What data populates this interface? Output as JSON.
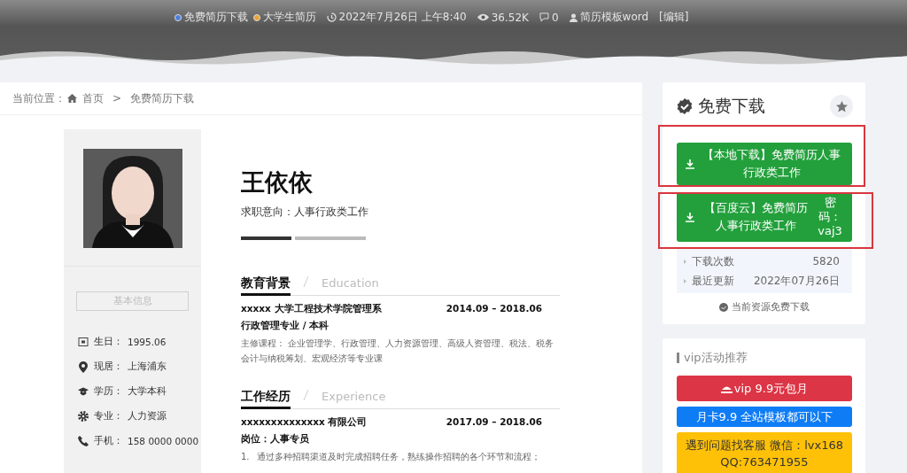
{
  "header": {
    "meta": [
      {
        "kind": "category",
        "text": "免费简历下载",
        "color": "#4a7fe0"
      },
      {
        "kind": "category",
        "text": "大学生简历",
        "color": "#e8a33a"
      },
      {
        "kind": "date",
        "text": "2022年7月26日 上午8:40"
      },
      {
        "kind": "views",
        "text": "36.52K"
      },
      {
        "kind": "comments",
        "text": "0"
      },
      {
        "kind": "author",
        "text": "简历模板word"
      },
      {
        "kind": "edit",
        "text": "[编辑]"
      }
    ]
  },
  "breadcrumb": {
    "label": "当前位置：",
    "separator": ">",
    "items": [
      "首页",
      "免费简历下载"
    ]
  },
  "resume": {
    "name": "王依依",
    "intention": "求职意向：人事行政类工作",
    "basic_title": "基本信息",
    "info": [
      {
        "kind": "calendar",
        "label": "生日：",
        "value": "1995.06"
      },
      {
        "kind": "pin",
        "label": "现居：",
        "value": "上海浦东"
      },
      {
        "kind": "cap",
        "label": "学历：",
        "value": "大学本科"
      },
      {
        "kind": "gear",
        "label": "专业：",
        "value": "人力资源"
      },
      {
        "kind": "phone",
        "label": "手机：",
        "value": "158 0000 0000"
      }
    ],
    "sections": [
      {
        "title": "教育背景",
        "subtitle": "Education",
        "entries": [
          {
            "org": "xxxxx 大学工程技术学院管理系",
            "date": "2014.09 – 2018.06",
            "role": "行政管理专业 / 本科",
            "text": "主修课程： 企业管理学、行政管理、人力资源管理、高级人资管理、税法、税务会计与纳税筹划、宏观经济等专业课"
          }
        ]
      },
      {
        "title": "工作经历",
        "subtitle": "Experience",
        "entries": [
          {
            "org": "xxxxxxxxxxxxxx 有限公司",
            "date": "2017.09 – 2018.06",
            "role": "岗位：人事专员",
            "items": [
              {
                "number": "1.",
                "text": "通过多种招聘渠道及时完成招聘任务，熟练操作招聘的各个环节和流程；"
              }
            ]
          }
        ]
      }
    ]
  },
  "sidebar": {
    "download": {
      "title": "免费下载",
      "buttons": [
        {
          "text": "【本地下载】免费简历人事行政类工作",
          "highlighted": true
        },
        {
          "text": "【百度云】免费简历人事行政类工作",
          "extra": "密码：vaj3",
          "highlighted": true
        }
      ],
      "stats": [
        {
          "label": "下载次数",
          "value": "5820"
        },
        {
          "label": "最近更新",
          "value": "2022年07月26日"
        }
      ],
      "note": "当前资源免费下载"
    },
    "vip": {
      "title": "vip活动推荐",
      "buttons": [
        {
          "kind": "red",
          "icon": true,
          "lines": [
            "vip 9.9元包月"
          ]
        },
        {
          "kind": "blue",
          "icon": false,
          "lines": [
            "月卡9.9 全站模板都可以下"
          ]
        },
        {
          "kind": "yellow",
          "icon": false,
          "lines": [
            "遇到问题找客服 微信：lvx168",
            "QQ:763471955"
          ]
        }
      ]
    }
  }
}
